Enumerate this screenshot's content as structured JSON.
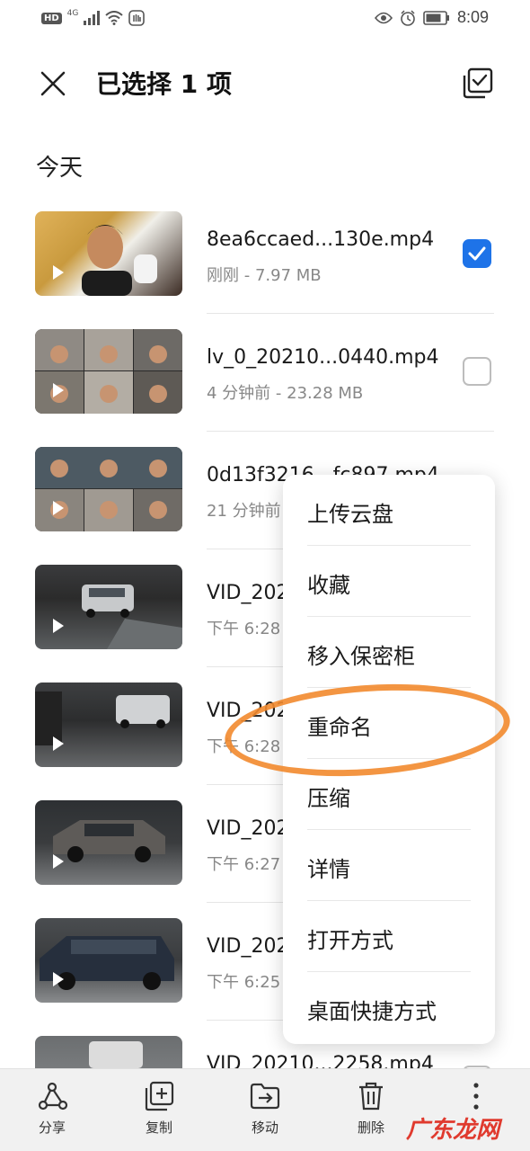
{
  "status_bar": {
    "left_badge": "HD",
    "network": "4G",
    "time": "8:09"
  },
  "header": {
    "title": "已选择 1 项"
  },
  "section": {
    "title": "今天"
  },
  "files": [
    {
      "name": "8ea6ccaed...130e.mp4",
      "meta": "刚刚 - 7.97 MB",
      "checked": true
    },
    {
      "name": "lv_0_20210...0440.mp4",
      "meta": "4 分钟前 - 23.28 MB",
      "checked": false
    },
    {
      "name": "0d13f3216...fc897.mp4",
      "meta": "21 分钟前",
      "checked": false
    },
    {
      "name": "VID_202",
      "meta": "下午 6:28",
      "checked": false
    },
    {
      "name": "VID_202",
      "meta": "下午 6:28",
      "checked": false
    },
    {
      "name": "VID_202",
      "meta": "下午 6:27",
      "checked": false
    },
    {
      "name": "VID_202",
      "meta": "下午 6:25",
      "checked": false
    },
    {
      "name": "VID_20210...2258.mp4",
      "meta": "",
      "checked": false
    }
  ],
  "menu": {
    "items": [
      "上传云盘",
      "收藏",
      "移入保密柜",
      "重命名",
      "压缩",
      "详情",
      "打开方式",
      "桌面快捷方式"
    ]
  },
  "toolbar": {
    "share": "分享",
    "copy": "复制",
    "move": "移动",
    "delete": "删除"
  },
  "watermark": "广东龙网",
  "colors": {
    "accent": "#1e73e8",
    "annotation": "#f28a2e"
  }
}
